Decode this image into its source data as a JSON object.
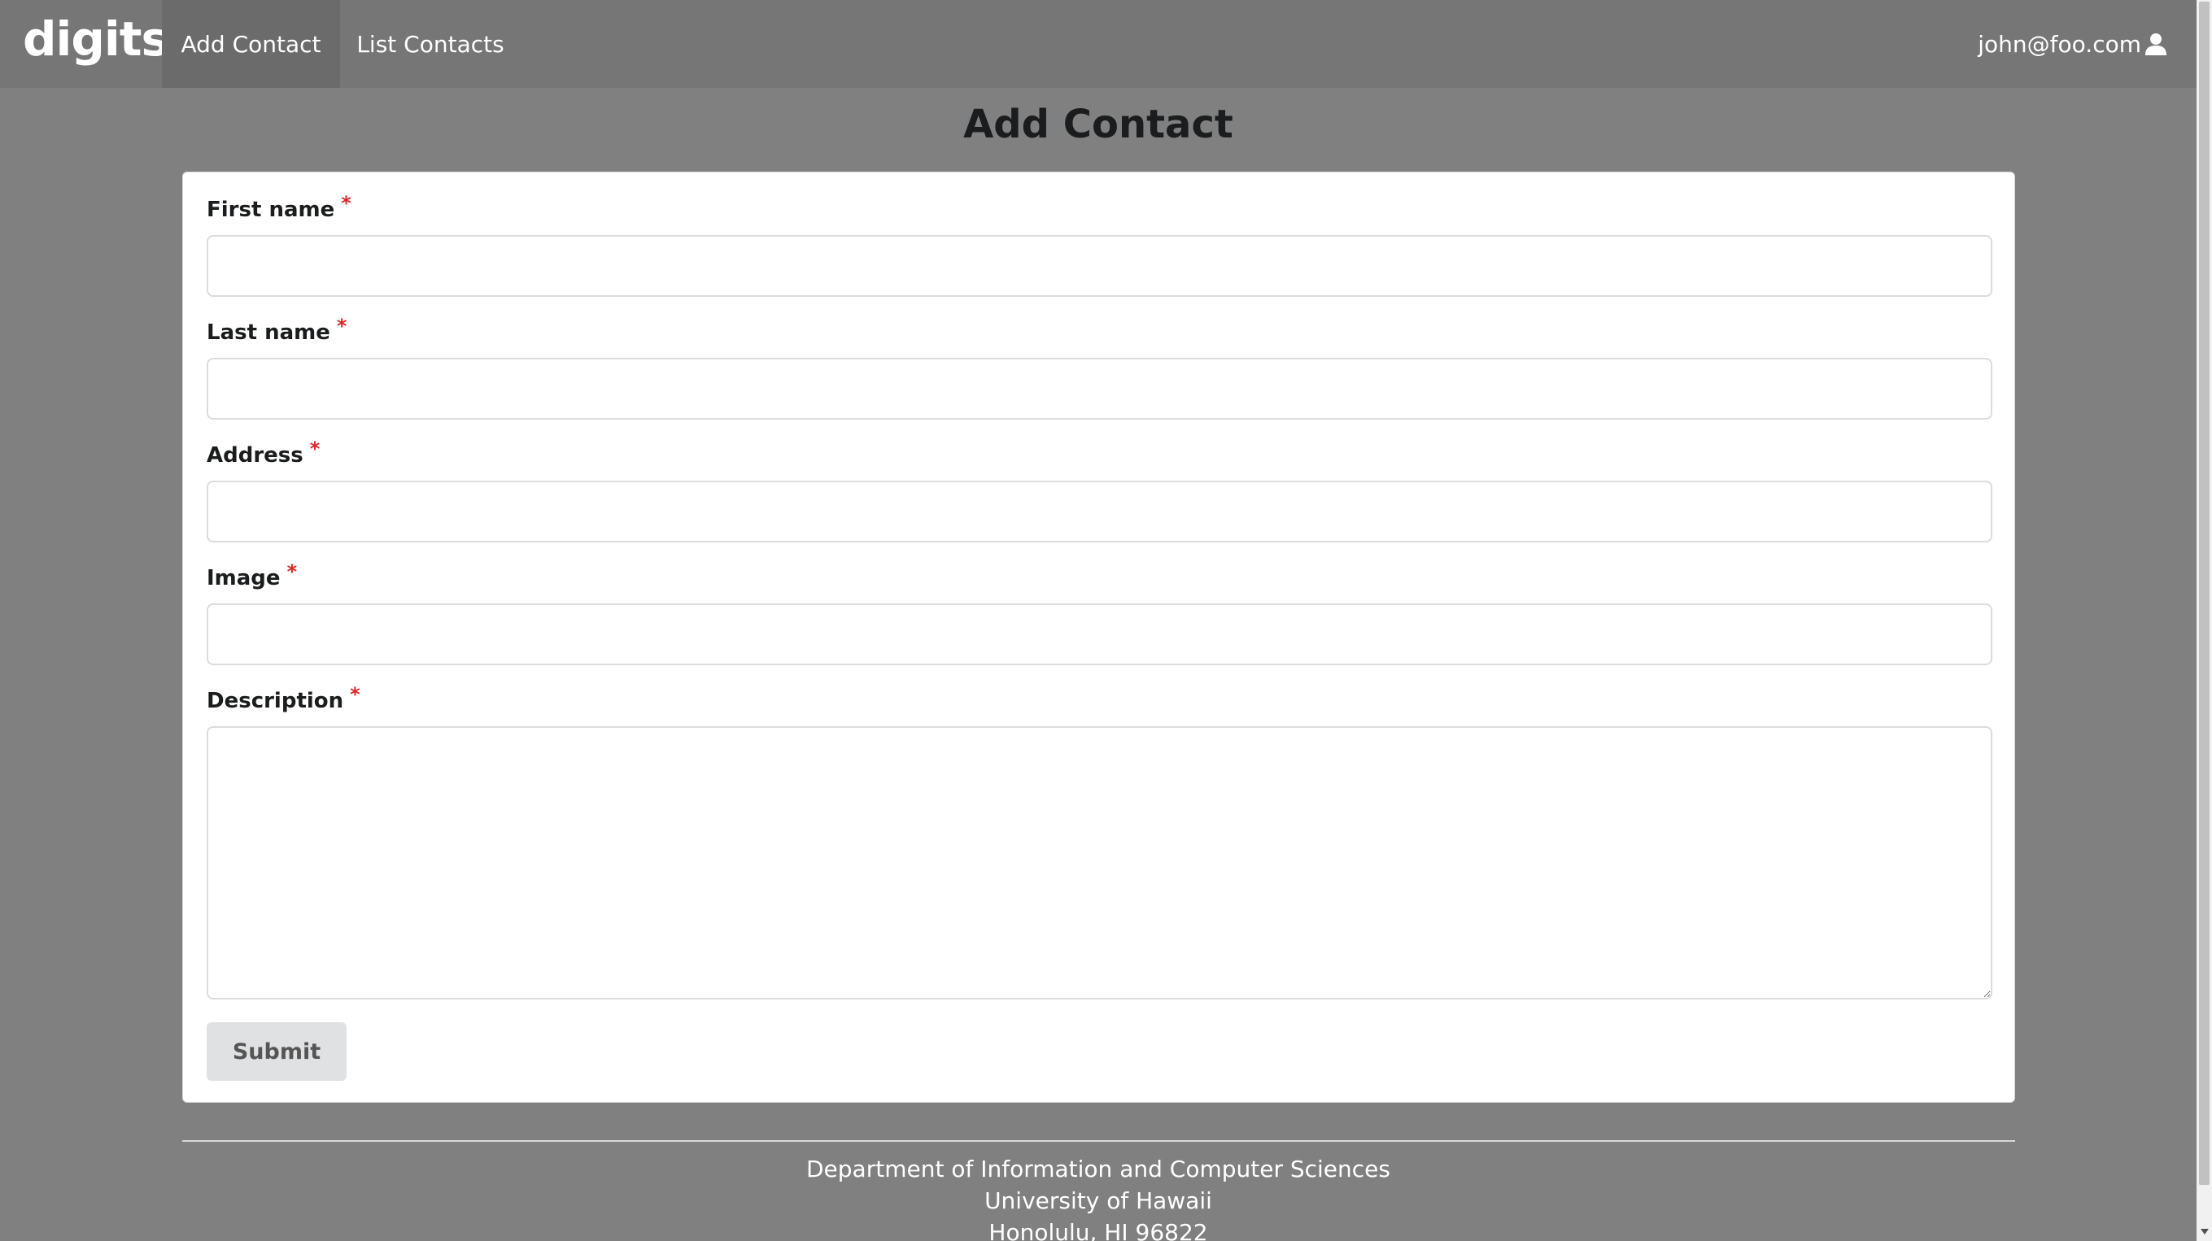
{
  "navbar": {
    "brand": "digits",
    "items": [
      {
        "label": "Add Contact",
        "active": true
      },
      {
        "label": "List Contacts",
        "active": false
      }
    ],
    "user": {
      "email": "john@foo.com",
      "icon": "user-icon"
    }
  },
  "page": {
    "title": "Add Contact"
  },
  "form": {
    "fields": [
      {
        "label": "First name",
        "required": "*",
        "value": ""
      },
      {
        "label": "Last name",
        "required": "*",
        "value": ""
      },
      {
        "label": "Address",
        "required": "*",
        "value": ""
      },
      {
        "label": "Image",
        "required": "*",
        "value": ""
      },
      {
        "label": "Description",
        "required": "*",
        "value": ""
      }
    ],
    "submit_label": "Submit"
  },
  "footer": {
    "line1": "Department of Information and Computer Sciences",
    "line2": "University of Hawaii",
    "line3": "Honolulu, HI 96822"
  },
  "colors": {
    "background": "#808080",
    "navbar": "#767676",
    "required": "#db2828",
    "button": "#e0e1e2"
  }
}
